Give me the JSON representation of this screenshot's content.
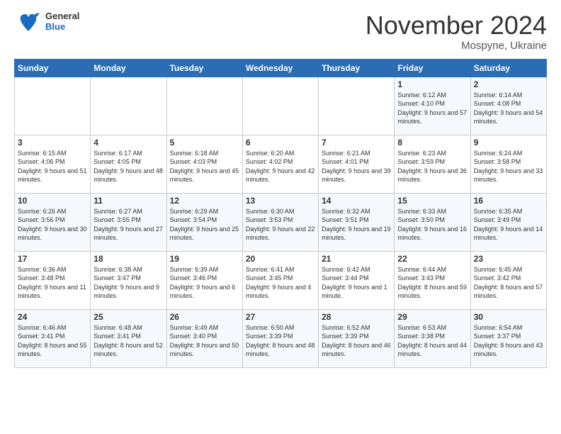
{
  "header": {
    "logo_general": "General",
    "logo_blue": "Blue",
    "month_title": "November 2024",
    "subtitle": "Mospyne, Ukraine"
  },
  "weekdays": [
    "Sunday",
    "Monday",
    "Tuesday",
    "Wednesday",
    "Thursday",
    "Friday",
    "Saturday"
  ],
  "weeks": [
    [
      {
        "day": "",
        "info": ""
      },
      {
        "day": "",
        "info": ""
      },
      {
        "day": "",
        "info": ""
      },
      {
        "day": "",
        "info": ""
      },
      {
        "day": "",
        "info": ""
      },
      {
        "day": "1",
        "info": "Sunrise: 6:12 AM\nSunset: 4:10 PM\nDaylight: 9 hours and 57 minutes."
      },
      {
        "day": "2",
        "info": "Sunrise: 6:14 AM\nSunset: 4:08 PM\nDaylight: 9 hours and 54 minutes."
      }
    ],
    [
      {
        "day": "3",
        "info": "Sunrise: 6:15 AM\nSunset: 4:06 PM\nDaylight: 9 hours and 51 minutes."
      },
      {
        "day": "4",
        "info": "Sunrise: 6:17 AM\nSunset: 4:05 PM\nDaylight: 9 hours and 48 minutes."
      },
      {
        "day": "5",
        "info": "Sunrise: 6:18 AM\nSunset: 4:03 PM\nDaylight: 9 hours and 45 minutes."
      },
      {
        "day": "6",
        "info": "Sunrise: 6:20 AM\nSunset: 4:02 PM\nDaylight: 9 hours and 42 minutes."
      },
      {
        "day": "7",
        "info": "Sunrise: 6:21 AM\nSunset: 4:01 PM\nDaylight: 9 hours and 39 minutes."
      },
      {
        "day": "8",
        "info": "Sunrise: 6:23 AM\nSunset: 3:59 PM\nDaylight: 9 hours and 36 minutes."
      },
      {
        "day": "9",
        "info": "Sunrise: 6:24 AM\nSunset: 3:58 PM\nDaylight: 9 hours and 33 minutes."
      }
    ],
    [
      {
        "day": "10",
        "info": "Sunrise: 6:26 AM\nSunset: 3:56 PM\nDaylight: 9 hours and 30 minutes."
      },
      {
        "day": "11",
        "info": "Sunrise: 6:27 AM\nSunset: 3:55 PM\nDaylight: 9 hours and 27 minutes."
      },
      {
        "day": "12",
        "info": "Sunrise: 6:29 AM\nSunset: 3:54 PM\nDaylight: 9 hours and 25 minutes."
      },
      {
        "day": "13",
        "info": "Sunrise: 6:30 AM\nSunset: 3:53 PM\nDaylight: 9 hours and 22 minutes."
      },
      {
        "day": "14",
        "info": "Sunrise: 6:32 AM\nSunset: 3:51 PM\nDaylight: 9 hours and 19 minutes."
      },
      {
        "day": "15",
        "info": "Sunrise: 6:33 AM\nSunset: 3:50 PM\nDaylight: 9 hours and 16 minutes."
      },
      {
        "day": "16",
        "info": "Sunrise: 6:35 AM\nSunset: 3:49 PM\nDaylight: 9 hours and 14 minutes."
      }
    ],
    [
      {
        "day": "17",
        "info": "Sunrise: 6:36 AM\nSunset: 3:48 PM\nDaylight: 9 hours and 11 minutes."
      },
      {
        "day": "18",
        "info": "Sunrise: 6:38 AM\nSunset: 3:47 PM\nDaylight: 9 hours and 9 minutes."
      },
      {
        "day": "19",
        "info": "Sunrise: 6:39 AM\nSunset: 3:46 PM\nDaylight: 9 hours and 6 minutes."
      },
      {
        "day": "20",
        "info": "Sunrise: 6:41 AM\nSunset: 3:45 PM\nDaylight: 9 hours and 4 minutes."
      },
      {
        "day": "21",
        "info": "Sunrise: 6:42 AM\nSunset: 3:44 PM\nDaylight: 9 hours and 1 minute."
      },
      {
        "day": "22",
        "info": "Sunrise: 6:44 AM\nSunset: 3:43 PM\nDaylight: 8 hours and 59 minutes."
      },
      {
        "day": "23",
        "info": "Sunrise: 6:45 AM\nSunset: 3:42 PM\nDaylight: 8 hours and 57 minutes."
      }
    ],
    [
      {
        "day": "24",
        "info": "Sunrise: 6:46 AM\nSunset: 3:41 PM\nDaylight: 8 hours and 55 minutes."
      },
      {
        "day": "25",
        "info": "Sunrise: 6:48 AM\nSunset: 3:41 PM\nDaylight: 8 hours and 52 minutes."
      },
      {
        "day": "26",
        "info": "Sunrise: 6:49 AM\nSunset: 3:40 PM\nDaylight: 8 hours and 50 minutes."
      },
      {
        "day": "27",
        "info": "Sunrise: 6:50 AM\nSunset: 3:39 PM\nDaylight: 8 hours and 48 minutes."
      },
      {
        "day": "28",
        "info": "Sunrise: 6:52 AM\nSunset: 3:39 PM\nDaylight: 8 hours and 46 minutes."
      },
      {
        "day": "29",
        "info": "Sunrise: 6:53 AM\nSunset: 3:38 PM\nDaylight: 8 hours and 44 minutes."
      },
      {
        "day": "30",
        "info": "Sunrise: 6:54 AM\nSunset: 3:37 PM\nDaylight: 8 hours and 43 minutes."
      }
    ]
  ]
}
